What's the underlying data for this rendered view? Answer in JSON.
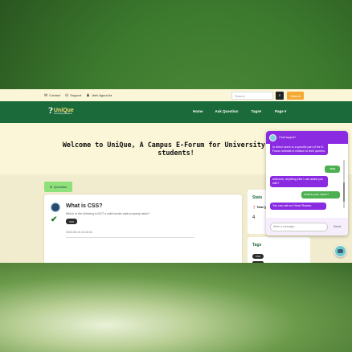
{
  "topbar": {
    "contact": "Contact",
    "support": "Support",
    "user": "Jireh Agura Ila",
    "search_placeholder": "Search",
    "submit": "Submit"
  },
  "nav": {
    "logo_name": "UniQue",
    "logo_sub": "University Questions",
    "links": [
      "Home",
      "Ask Question",
      "Tags",
      "Page"
    ]
  },
  "hero": {
    "title": "Welcome to UniQue, A Campus E-Forum for University Salle students!"
  },
  "main": {
    "question_button": "Question",
    "question": {
      "title": "What is CSS?",
      "description": "Which of the following is NOT a valid border-style property value?",
      "tag": "CSS",
      "date": "2023-05-10 21:40:41"
    },
    "stats": {
      "title": "Stats",
      "row_label": "Total Qu",
      "value": "4"
    },
    "tags": {
      "title": "Tags",
      "chip": "CSS"
    }
  },
  "chat": {
    "header": "Chat support",
    "messages": [
      {
        "from": "bot",
        "text": "to direct users to a specific part of the E-Forum website in relation to their queries."
      },
      {
        "from": "user",
        "text": "okay"
      },
      {
        "from": "bot",
        "text": "welcome, anything else i can assist you with?"
      },
      {
        "from": "user",
        "text": "what is your name?"
      },
      {
        "from": "bot",
        "text": "You can call me Hima! Reader."
      }
    ],
    "input_placeholder": "Write a message...",
    "send": "Send"
  },
  "colors": {
    "nav_green": "#1a6a3a",
    "chat_purple": "#8a2be2",
    "user_green": "#4caf50",
    "submit_orange": "#f4a933",
    "question_button": "#8ee07a"
  }
}
